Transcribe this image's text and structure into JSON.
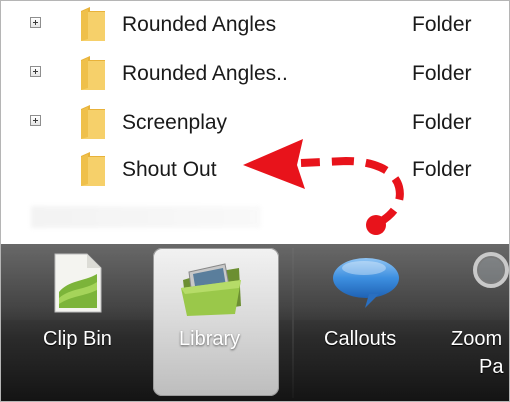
{
  "tree": {
    "rows": [
      {
        "name": "Rounded Angles",
        "type": "Folder",
        "expandable": true
      },
      {
        "name": "Rounded Angles..",
        "type": "Folder",
        "expandable": true
      },
      {
        "name": "Screenplay",
        "type": "Folder",
        "expandable": true
      },
      {
        "name": "Shout Out",
        "type": "Folder",
        "expandable": false
      }
    ]
  },
  "annotation": {
    "arrow_color": "#e8131b"
  },
  "toolbar": {
    "clip_bin_label": "Clip Bin",
    "library_label": "Library",
    "callouts_label": "Callouts",
    "zoom_label": "Zoom",
    "zoom_label_line2": "Pa",
    "active_tab": "Library"
  },
  "icons": {
    "expander": "plus-expander-icon",
    "folder": "folder-icon",
    "clip_bin": "clip-bin-icon",
    "library": "library-folder-icon",
    "callouts": "speech-bubble-icon",
    "zoom": "magnifier-icon"
  },
  "colors": {
    "folder_yellow": "#f4cd5c",
    "toolbar_dark": "#2b2b2b",
    "callout_blue": "#3d8fe0"
  }
}
